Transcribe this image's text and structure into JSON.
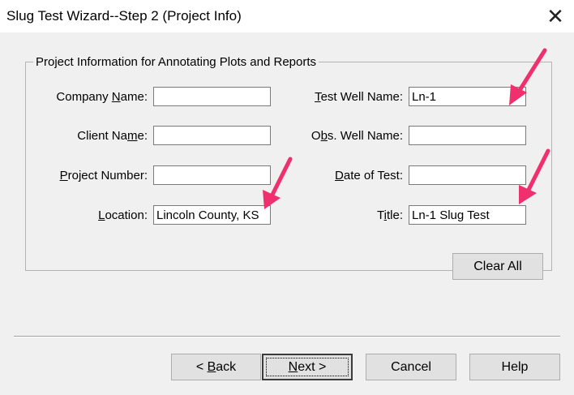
{
  "window": {
    "title": "Slug Test Wizard--Step 2 (Project Info)",
    "close_glyph": "✕"
  },
  "group": {
    "legend": "Project Information for Annotating Plots and Reports"
  },
  "fields": {
    "company_name": {
      "label_pre": "Company ",
      "label_key": "N",
      "label_post": "ame:",
      "value": ""
    },
    "client_name": {
      "label_pre": "Client Na",
      "label_key": "m",
      "label_post": "e:",
      "value": ""
    },
    "project_number": {
      "label_pre": "",
      "label_key": "P",
      "label_post": "roject Number:",
      "value": ""
    },
    "location": {
      "label_pre": "",
      "label_key": "L",
      "label_post": "ocation:",
      "value": "Lincoln County, KS"
    },
    "test_well_name": {
      "label_pre": "",
      "label_key": "T",
      "label_post": "est Well Name:",
      "value": "Ln-1"
    },
    "obs_well_name": {
      "label_pre": "O",
      "label_key": "b",
      "label_post": "s. Well Name:",
      "value": ""
    },
    "date_of_test": {
      "label_pre": "",
      "label_key": "D",
      "label_post": "ate of Test:",
      "value": ""
    },
    "title": {
      "label_pre": "T",
      "label_key": "i",
      "label_post": "tle:",
      "value": "Ln-1 Slug Test"
    }
  },
  "buttons": {
    "clear_all": "Clear All",
    "back_pre": "< ",
    "back_key": "B",
    "back_post": "ack",
    "next_key": "N",
    "next_post": "ext >",
    "cancel": "Cancel",
    "help": "Help"
  },
  "colors": {
    "annotation_arrow": "#f0306e"
  }
}
